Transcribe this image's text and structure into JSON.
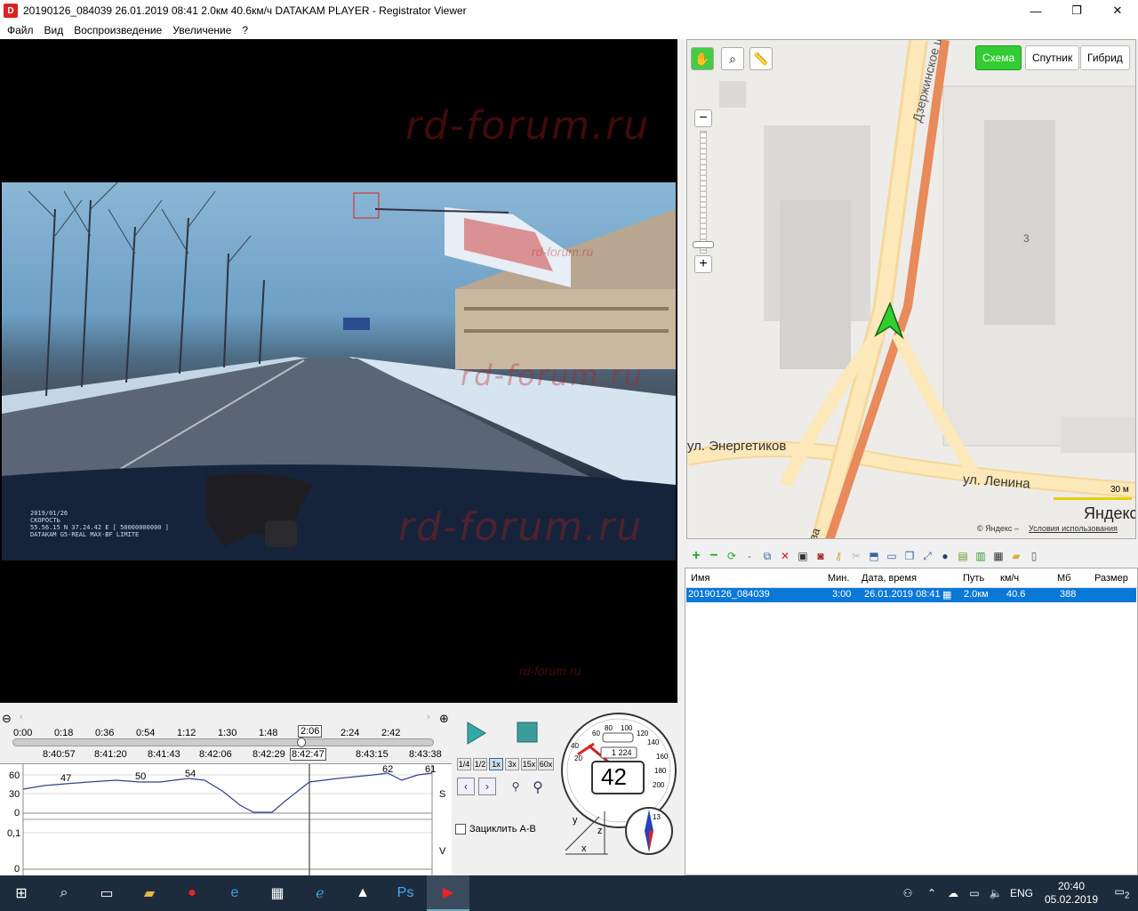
{
  "window": {
    "title": "20190126_084039    26.01.2019 08:41    2.0км    40.6км/ч    DATAKAM PLAYER - Registrator Viewer",
    "minimize": "—",
    "maximize": "❐",
    "close": "✕"
  },
  "menu": [
    "Файл",
    "Вид",
    "Воспроизведение",
    "Увеличение",
    "?"
  ],
  "watermark": "rd-forum.ru",
  "video_overlay": [
    "2019/01/26",
    "СКОРОСТЬ",
    "55.56.15 N 37.24.42 E       [ 50000000000 ]",
    "DATAKAM G5-REAL MAX-BF LIMITE"
  ],
  "timeline": {
    "top_ticks": [
      "0:00",
      "0:18",
      "0:36",
      "0:54",
      "1:12",
      "1:30",
      "1:48",
      "2:06",
      "2:24",
      "2:42"
    ],
    "current": "2:06",
    "bottom_ticks": [
      "8:40:57",
      "8:41:20",
      "8:41:43",
      "8:42:06",
      "8:42:29",
      "8:42:47",
      "8:43:15",
      "8:43:38"
    ],
    "current_clock": "8:42:47",
    "progress": 0.69
  },
  "graph": {
    "s_axis": [
      "60",
      "30",
      "0"
    ],
    "v_axis": [
      "0,1",
      "0"
    ],
    "peaks": [
      "47",
      "50",
      "54",
      "62",
      "61"
    ],
    "s_label": "S",
    "v_label": "V"
  },
  "controls": {
    "speeds": [
      "1/4",
      "1/2",
      "1x",
      "3x",
      "15x",
      "60x"
    ],
    "active_speed": "1x",
    "loop_label": "Зациклить А-В"
  },
  "speedometer": {
    "ticks": [
      "20",
      "40",
      "60",
      "80",
      "100",
      "120",
      "140",
      "160",
      "180",
      "200"
    ],
    "odometer": "1 224",
    "speed": "42",
    "compass_value": "13"
  },
  "axes_labels": [
    "y",
    "z",
    "x"
  ],
  "map": {
    "types": [
      "Схема",
      "Спутник",
      "Гибрид"
    ],
    "active_type": "Схема",
    "streets": [
      "Дзержинское ш.",
      "ул. Энергетиков",
      "ул. Ленина",
      "ва"
    ],
    "building_number": "3",
    "scale": "30 м",
    "brand": "Яндекс",
    "copyright": "© Яндекс – ",
    "terms": "Условия использования"
  },
  "list": {
    "columns": [
      "Имя",
      "Мин.",
      "Дата, время",
      "Путь",
      "км/ч",
      "Мб",
      "Размер"
    ],
    "rows": [
      {
        "name": "20190126_084039",
        "min": "3:00",
        "datetime": "26.01.2019 08:41",
        "path": "2.0км",
        "speed": "40.6",
        "mb": "388"
      }
    ]
  },
  "taskbar": {
    "lang": "ENG",
    "time": "20:40",
    "date": "05.02.2019",
    "notif": "2"
  }
}
